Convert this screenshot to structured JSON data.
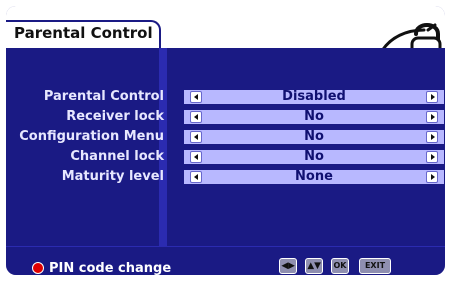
{
  "window": {
    "title": "Parental Control"
  },
  "settings": [
    {
      "label": "Parental Control",
      "value": "Disabled"
    },
    {
      "label": "Receiver lock",
      "value": "No"
    },
    {
      "label": "Configuration Menu",
      "value": "No"
    },
    {
      "label": "Channel lock",
      "value": "No"
    },
    {
      "label": "Maturity level",
      "value": "None"
    }
  ],
  "footer": {
    "pin_label": "PIN code change",
    "ok_key_label": "OK",
    "exit_key_label": "EXIT"
  },
  "colors": {
    "background": "#1a1a84",
    "field": "#b8b8ff",
    "accent_red": "#e00000"
  },
  "icons": {
    "lock": "padlock-icon",
    "left_arrow": "left-arrow-icon",
    "right_arrow": "right-arrow-icon",
    "left_right_key": "left-right-key-icon",
    "up_down_key": "up-down-key-icon"
  }
}
